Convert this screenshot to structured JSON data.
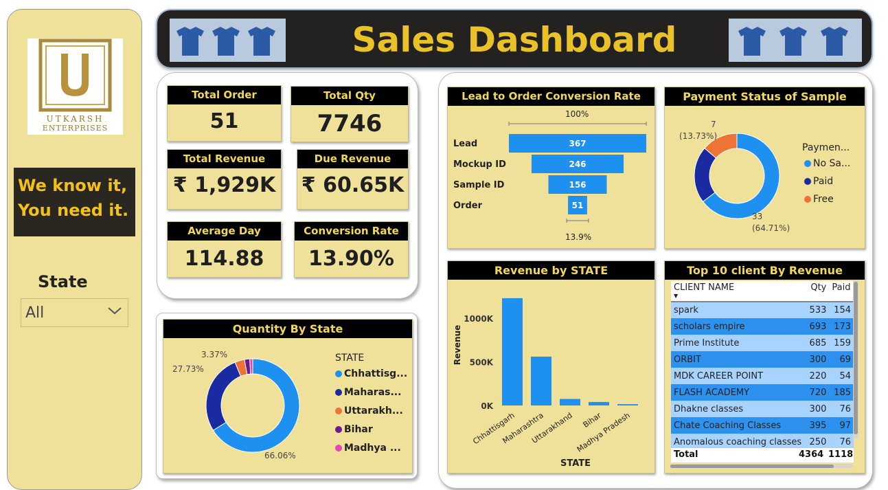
{
  "sidebar": {
    "logo_text_1": "UTKARSH",
    "logo_text_2": "ENTERPRISES",
    "slogan_line1": "We know it,",
    "slogan_line2": "You need it.",
    "state_label": "State",
    "state_value": "All"
  },
  "header": {
    "title": "Sales Dashboard"
  },
  "kpis": {
    "total_order": {
      "label": "Total Order",
      "value": "51"
    },
    "total_qty": {
      "label": "Total Qty",
      "value": "7746"
    },
    "total_revenue": {
      "label": "Total Revenue",
      "value": "₹ 1,929K"
    },
    "due_revenue": {
      "label": "Due Revenue",
      "value": "₹ 60.65K"
    },
    "average_day": {
      "label": "Average Day",
      "value": "114.88"
    },
    "conversion_rate": {
      "label": "Conversion Rate",
      "value": "13.90%"
    }
  },
  "quantity_by_state": {
    "title": "Quantity By State",
    "legend_title": "STATE",
    "legend": [
      {
        "label": "Chhattisg...",
        "color": "#1e90f0"
      },
      {
        "label": "Maharas...",
        "color": "#1a2aa0"
      },
      {
        "label": "Uttarakh...",
        "color": "#ee7436"
      },
      {
        "label": "Bihar",
        "color": "#6a1a8e"
      },
      {
        "label": "Madhya ...",
        "color": "#e646b4"
      }
    ],
    "label_a": "3.37%",
    "label_b": "27.73%",
    "label_c": "66.06%"
  },
  "funnel": {
    "title": "Lead to Order Conversion Rate",
    "top_label": "100%",
    "bottom_label": "13.9%",
    "stages": [
      {
        "label": "Lead",
        "value": "367"
      },
      {
        "label": "Mockup ID",
        "value": "246"
      },
      {
        "label": "Sample ID",
        "value": "156"
      },
      {
        "label": "Order",
        "value": "51"
      }
    ]
  },
  "payment_status": {
    "title": "Payment Status of Sample",
    "legend_title": "Paymen...",
    "legend": [
      {
        "label": "No Sa...",
        "color": "#1e90f0"
      },
      {
        "label": "Paid",
        "color": "#1a2aa0"
      },
      {
        "label": "Free",
        "color": "#ee7436"
      }
    ],
    "label_top_value": "7",
    "label_top_pct": "(13.73%)",
    "label_bottom_value": "33",
    "label_bottom_pct": "(64.71%)"
  },
  "revenue_by_state": {
    "title": "Revenue by STATE"
  },
  "top_clients": {
    "title": "Top 10 client By Revenue",
    "col_name": "CLIENT NAME",
    "col_qty": "Qty",
    "col_paid": "Paid",
    "rows": [
      {
        "name": "spark",
        "qty": "533",
        "paid": "154"
      },
      {
        "name": "scholars empire",
        "qty": "693",
        "paid": "173"
      },
      {
        "name": "Prime Institute",
        "qty": "685",
        "paid": "159"
      },
      {
        "name": "ORBIT",
        "qty": "300",
        "paid": "69"
      },
      {
        "name": "MDK CAREER POINT",
        "qty": "220",
        "paid": "54"
      },
      {
        "name": "FLASH ACADEMY",
        "qty": "720",
        "paid": "185"
      },
      {
        "name": "Dhakne classes",
        "qty": "300",
        "paid": "76"
      },
      {
        "name": "Chate Coaching Classes",
        "qty": "395",
        "paid": "97"
      },
      {
        "name": "Anomalous coaching classes",
        "qty": "250",
        "paid": "76"
      }
    ],
    "total_label": "Total",
    "total_qty": "4364",
    "total_paid": "1118("
  },
  "chart_data": [
    {
      "type": "bar",
      "title": "Quantity By State",
      "categories": [
        "Chhattisg...",
        "Maharas...",
        "Uttarakh...",
        "Bihar",
        "Madhya ..."
      ],
      "values": [
        66.06,
        27.73,
        3.37,
        1.8,
        1.04
      ],
      "chart_style": "donut",
      "colors": [
        "#1e90f0",
        "#1a2aa0",
        "#ee7436",
        "#6a1a8e",
        "#e646b4"
      ]
    },
    {
      "type": "bar",
      "title": "Lead to Order Conversion Rate",
      "categories": [
        "Lead",
        "Mockup ID",
        "Sample ID",
        "Order"
      ],
      "values": [
        367,
        246,
        156,
        51
      ],
      "chart_style": "funnel"
    },
    {
      "type": "pie",
      "title": "Payment Status of Sample",
      "categories": [
        "No Sa...",
        "Paid",
        "Free"
      ],
      "values": [
        33,
        11,
        7
      ],
      "chart_style": "donut",
      "colors": [
        "#1e90f0",
        "#1a2aa0",
        "#ee7436"
      ]
    },
    {
      "type": "bar",
      "title": "Revenue by STATE",
      "xlabel": "STATE",
      "ylabel": "Revenue",
      "categories": [
        "Chhattisgarh",
        "Maharashtra",
        "Uttarakhand",
        "Bihar",
        "Madhya Pradesh"
      ],
      "values": [
        1230000,
        560000,
        75000,
        40000,
        15000
      ],
      "ylim": [
        0,
        1300000
      ],
      "yticks": [
        "0K",
        "500K",
        "1000K"
      ],
      "ytick_values": [
        0,
        500000,
        1000000
      ],
      "color": "#1e90f0"
    }
  ]
}
